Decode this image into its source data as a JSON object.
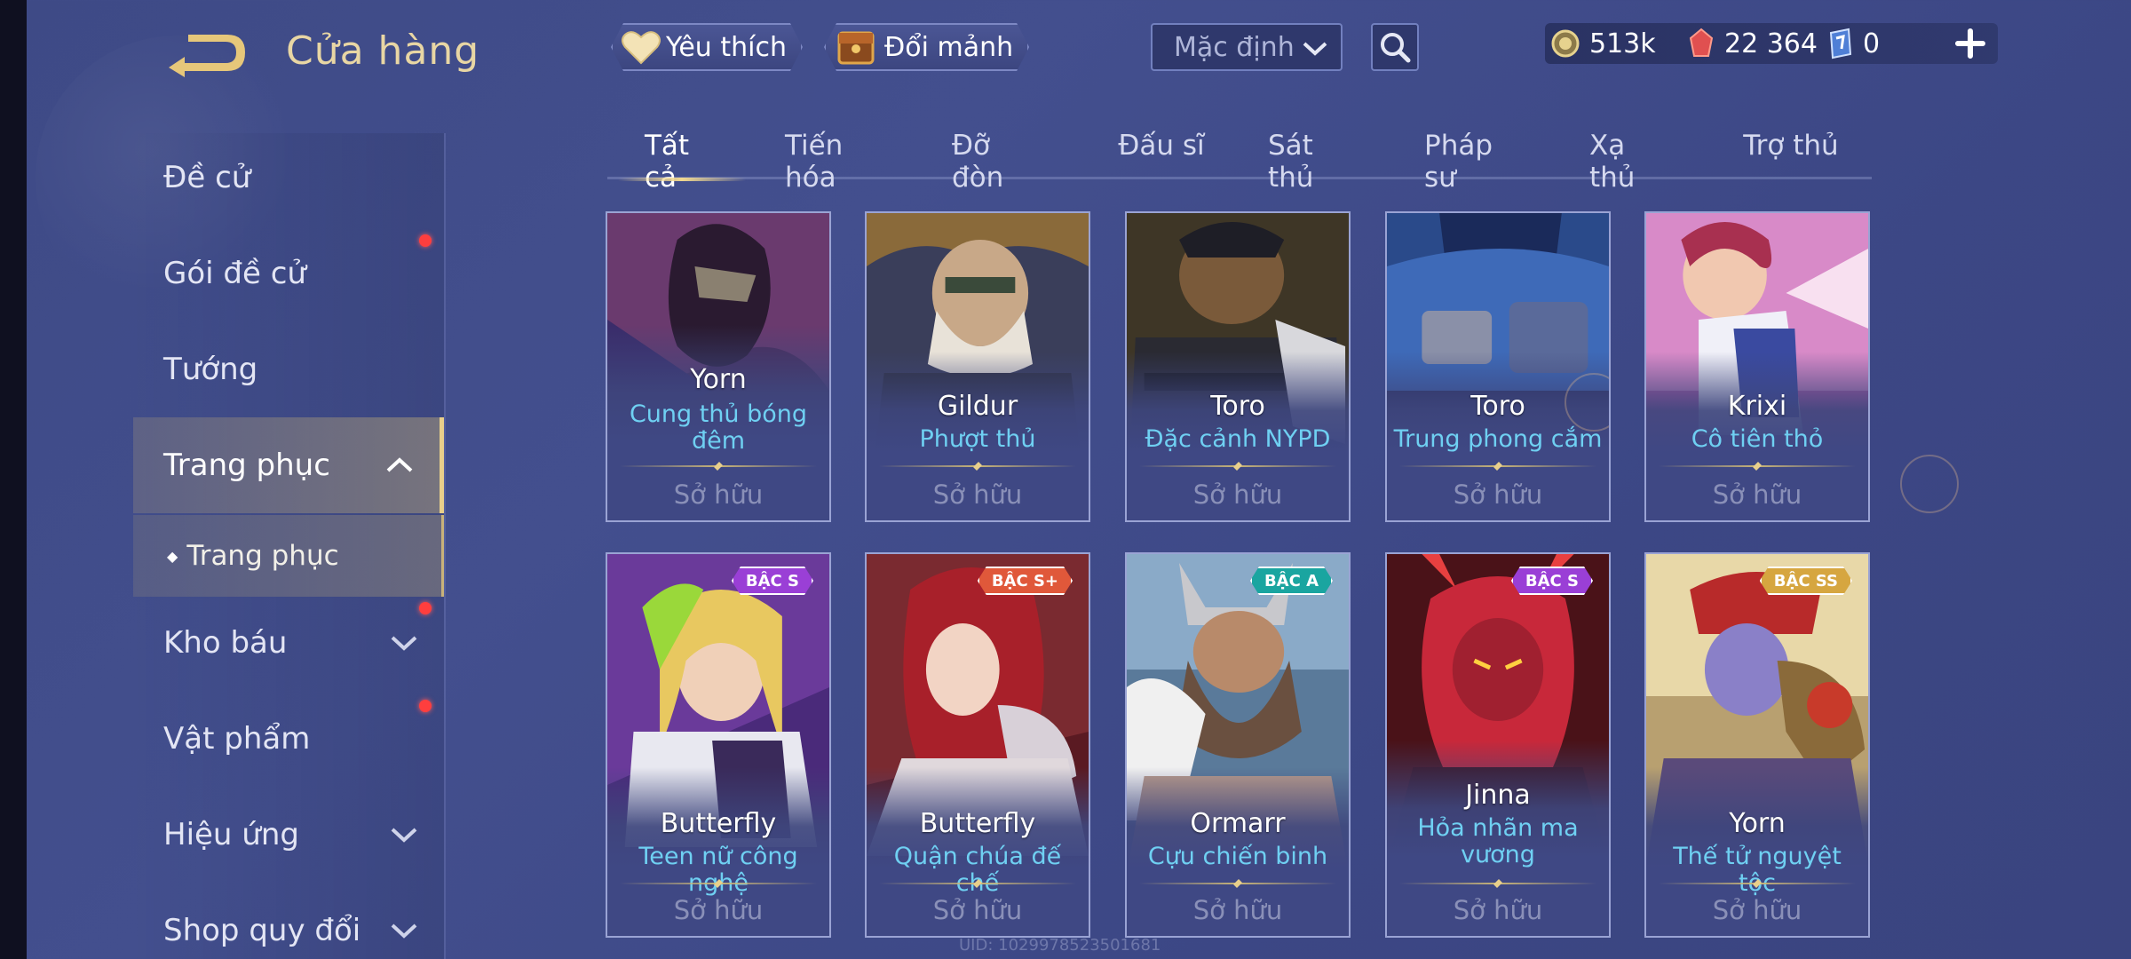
{
  "header": {
    "title": "Cửa hàng"
  },
  "sidebar": {
    "items": [
      {
        "label": "Đề cử"
      },
      {
        "label": "Gói đề cử"
      },
      {
        "label": "Tướng"
      },
      {
        "label": "Trang phục"
      },
      {
        "label": "Kho báu"
      },
      {
        "label": "Vật phẩm"
      },
      {
        "label": "Hiệu ứng"
      },
      {
        "label": "Shop quy đổi"
      }
    ],
    "sub_item": "Trang phục"
  },
  "toolbar": {
    "favorite_label": "Yêu thích",
    "exchange_label": "Đổi mảnh",
    "sort_selected": "Mặc định"
  },
  "currency": {
    "gold": "513k",
    "vouchers": "22 364",
    "fragments": "0"
  },
  "tabs": [
    {
      "label": "Tất cả"
    },
    {
      "label": "Tiến hóa"
    },
    {
      "label": "Đỡ đòn"
    },
    {
      "label": "Đấu sĩ"
    },
    {
      "label": "Sát thủ"
    },
    {
      "label": "Pháp sư"
    },
    {
      "label": "Xạ thủ"
    },
    {
      "label": "Trợ thủ"
    }
  ],
  "cards": [
    {
      "hero": "Yorn",
      "skin": "Cung thủ bóng đêm",
      "status": "Sở hữu",
      "badge": ""
    },
    {
      "hero": "Gildur",
      "skin": "Phượt thủ",
      "status": "Sở hữu",
      "badge": ""
    },
    {
      "hero": "Toro",
      "skin": "Đặc cảnh NYPD",
      "status": "Sở hữu",
      "badge": ""
    },
    {
      "hero": "Toro",
      "skin": "Trung phong cắm",
      "status": "Sở hữu",
      "badge": ""
    },
    {
      "hero": "Krixi",
      "skin": "Cô tiên thỏ",
      "status": "Sở hữu",
      "badge": ""
    },
    {
      "hero": "Butterfly",
      "skin": "Teen nữ công nghệ",
      "status": "Sở hữu",
      "badge": "BẬC S"
    },
    {
      "hero": "Butterfly",
      "skin": "Quận chúa đế chế",
      "status": "Sở hữu",
      "badge": "BẬC S+"
    },
    {
      "hero": "Ormarr",
      "skin": "Cựu chiến binh",
      "status": "Sở hữu",
      "badge": "BẬC A"
    },
    {
      "hero": "Jinna",
      "skin": "Hỏa nhãn ma vương",
      "status": "Sở hữu",
      "badge": "BẬC S"
    },
    {
      "hero": "Yorn",
      "skin": "Thế tử nguyệt tộc",
      "status": "Sở hữu",
      "badge": "BẬC SS"
    }
  ],
  "footer": {
    "uid": "UID: 1029978523501681"
  },
  "colors": {
    "accent_gold": "#e8cf8b",
    "skin_name": "#6fd0f2",
    "owned_text": "#8a90b8",
    "badge_s": "#9a3fd6",
    "badge_s_plus": "#e0583a",
    "badge_a": "#1aa5a0",
    "badge_ss": "#d6a640",
    "notification": "#ff3e3e"
  }
}
